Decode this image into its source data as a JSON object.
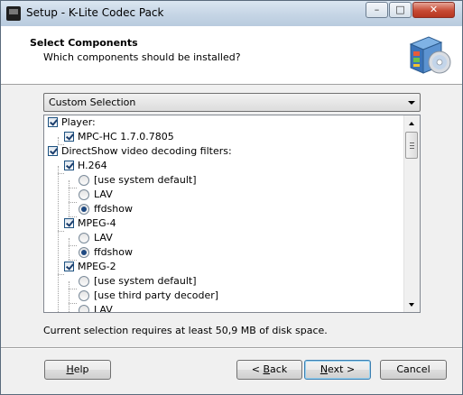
{
  "window": {
    "title": "Setup - K-Lite Codec Pack",
    "controls": {
      "minimize": "–",
      "maximize": "□",
      "close": "✕"
    }
  },
  "header": {
    "title": "Select Components",
    "subtitle": "Which components should be installed?",
    "logo_icon": "codec-pack-box-icon"
  },
  "dropdown": {
    "selected": "Custom Selection"
  },
  "components": [
    {
      "label": "Player:",
      "control": "checkbox",
      "checked": true,
      "level": 0
    },
    {
      "label": "MPC-HC 1.7.0.7805",
      "control": "checkbox",
      "checked": true,
      "level": 1
    },
    {
      "label": "DirectShow video decoding filters:",
      "control": "checkbox",
      "checked": true,
      "level": 0
    },
    {
      "label": "H.264",
      "control": "checkbox",
      "checked": true,
      "level": 1
    },
    {
      "label": "[use system default]",
      "control": "radio",
      "checked": false,
      "level": 2
    },
    {
      "label": "LAV",
      "control": "radio",
      "checked": false,
      "level": 2
    },
    {
      "label": "ffdshow",
      "control": "radio",
      "checked": true,
      "level": 2
    },
    {
      "label": "MPEG-4",
      "control": "checkbox",
      "checked": true,
      "level": 1
    },
    {
      "label": "LAV",
      "control": "radio",
      "checked": false,
      "level": 2
    },
    {
      "label": "ffdshow",
      "control": "radio",
      "checked": true,
      "level": 2
    },
    {
      "label": "MPEG-2",
      "control": "checkbox",
      "checked": true,
      "level": 1
    },
    {
      "label": "[use system default]",
      "control": "radio",
      "checked": false,
      "level": 2
    },
    {
      "label": "[use third party decoder]",
      "control": "radio",
      "checked": false,
      "level": 2
    },
    {
      "label": "LAV",
      "control": "radio",
      "checked": false,
      "level": 2
    }
  ],
  "disk_space_text": "Current selection requires at least 50,9 MB of disk space.",
  "buttons": {
    "help": {
      "label": "Help",
      "accel": "H",
      "rest": "elp"
    },
    "back": {
      "label": "< Back",
      "prefix": "< ",
      "accel": "B",
      "rest": "ack"
    },
    "next": {
      "label": "Next >",
      "accel": "N",
      "rest": "ext >"
    },
    "cancel": {
      "label": "Cancel"
    }
  }
}
